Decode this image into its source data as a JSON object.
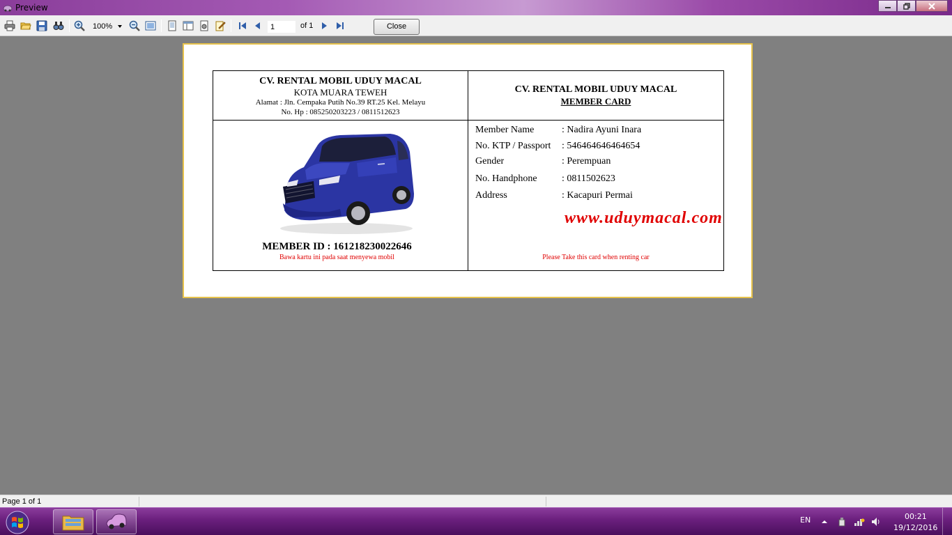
{
  "window": {
    "title": "Preview"
  },
  "toolbar": {
    "zoom_value": "100%",
    "page_input": "1",
    "page_of": "of 1",
    "close_label": "Close",
    "icons": [
      "print-icon",
      "open-icon",
      "save-icon",
      "find-icon",
      "zoom-in-icon",
      "zoom-out-icon",
      "full-page-icon",
      "one-page-icon",
      "two-page-icon",
      "page-setup-icon",
      "edit-icon",
      "first-page-icon",
      "prev-page-icon",
      "next-page-icon",
      "last-page-icon"
    ]
  },
  "card": {
    "left_header": {
      "company": "CV. RENTAL MOBIL UDUY MACAL",
      "city": "KOTA MUARA TEWEH",
      "address": "Alamat : Jln. Cempaka Putih No.39 RT.25 Kel. Melayu",
      "phone": "No. Hp : 085250203223 / 0811512623"
    },
    "right_header": {
      "company": "CV. RENTAL MOBIL UDUY MACAL",
      "subtitle": "MEMBER CARD"
    },
    "member_id": "MEMBER ID : 161218230022646",
    "note_id": "Bawa kartu ini pada saat menyewa mobil",
    "note_right": "Please Take this card when renting car",
    "website": "www.uduymacal.com",
    "fields": [
      {
        "label": "Member Name",
        "value": ": Nadira Ayuni Inara"
      },
      {
        "label": "No. KTP / Passport",
        "value": ": 546464646464654"
      },
      {
        "label": "Gender",
        "value": ": Perempuan"
      },
      {
        "label": "No. Handphone",
        "value": ": 0811502623"
      },
      {
        "label": "Address",
        "value": ": Kacapuri Permai"
      }
    ],
    "accent_color": "#e00000"
  },
  "status": {
    "page_text": "Page 1 of 1"
  },
  "taskbar": {
    "language": "EN",
    "time": "00:21",
    "date": "19/12/2016"
  }
}
